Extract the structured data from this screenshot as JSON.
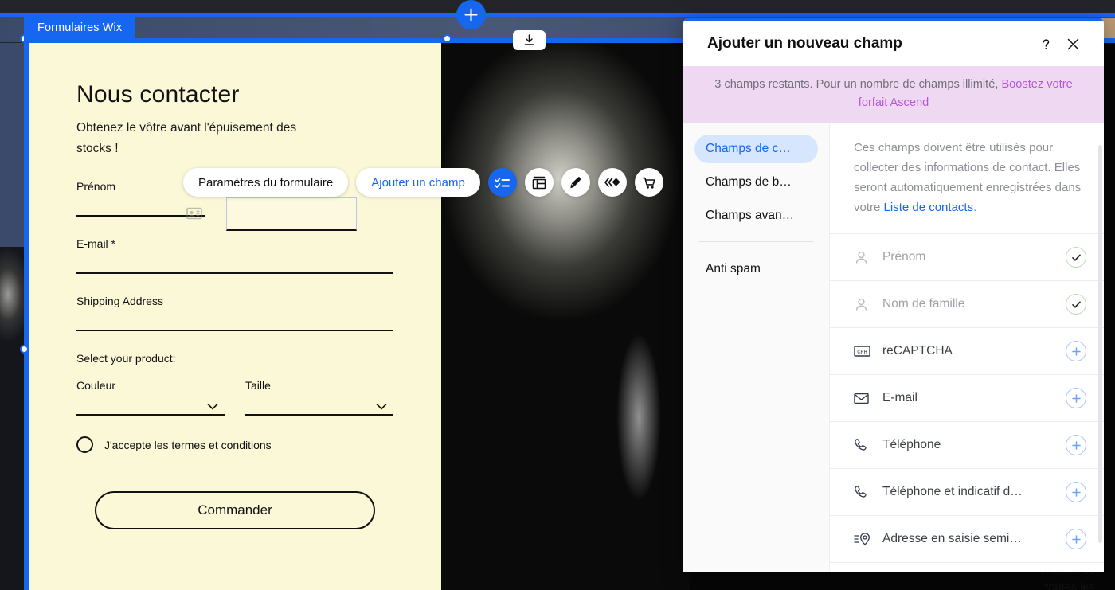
{
  "editor": {
    "site_tab_label": "Formulaires Wix",
    "add_section_icon": "plus-icon",
    "download_icon": "download-icon",
    "accent_blue": "#1666f0",
    "form_bg": "#fbf8d8"
  },
  "toolbar": {
    "settings_label": "Paramètres du formulaire",
    "add_field_label": "Ajouter un champ",
    "icons": [
      {
        "name": "form-fields-icon",
        "glyph": "checklist",
        "active": true
      },
      {
        "name": "layout-icon",
        "glyph": "layout",
        "active": false
      },
      {
        "name": "design-pen-icon",
        "glyph": "pen",
        "active": false
      },
      {
        "name": "animation-icon",
        "glyph": "chevrons",
        "active": false
      },
      {
        "name": "store-icon",
        "glyph": "cart",
        "active": false
      }
    ]
  },
  "form": {
    "title": "Nous contacter",
    "subtitle": "Obtenez le vôtre avant l'épuisement des stocks !",
    "fields": [
      {
        "label": "Prénom"
      },
      {
        "label": "E-mail *"
      },
      {
        "label": "Shipping Address"
      }
    ],
    "select_heading": "Select your product:",
    "selects": [
      {
        "label": "Couleur"
      },
      {
        "label": "Taille"
      }
    ],
    "terms_label": "J'accepte les termes et conditions",
    "submit_label": "Commander"
  },
  "panel": {
    "title": "Ajouter un nouveau champ",
    "help_icon": "question-mark-icon",
    "close_icon": "close-icon",
    "banner": {
      "text": "3 champs restants. Pour un nombre de champs illimité, ",
      "link": "Boostez votre forfait Ascend",
      "bg": "#efd9f2",
      "link_color": "#b857d6"
    },
    "categories": [
      {
        "label": "Champs de c…",
        "selected": true
      },
      {
        "label": "Champs de b…",
        "selected": false
      },
      {
        "label": "Champs avan…",
        "selected": false
      }
    ],
    "categories_extra": [
      {
        "label": "Anti spam",
        "selected": false
      }
    ],
    "description": {
      "part1": "Ces champs doivent être utilisés pour collecter des informations de contact. Elles seront automatiquement enregistrées dans votre ",
      "link": "Liste de contacts",
      "part2": "."
    },
    "fields": [
      {
        "label": "Prénom",
        "icon": "person-icon",
        "state": "added",
        "action": "check-icon"
      },
      {
        "label": "Nom de famille",
        "icon": "person-icon",
        "state": "added",
        "action": "check-icon"
      },
      {
        "label": "reCAPTCHA",
        "icon": "captcha-icon",
        "state": "available",
        "action": "plus-icon"
      },
      {
        "label": "E-mail",
        "icon": "envelope-icon",
        "state": "available",
        "action": "plus-icon"
      },
      {
        "label": "Téléphone",
        "icon": "phone-icon",
        "state": "available",
        "action": "plus-icon"
      },
      {
        "label": "Téléphone et indicatif d…",
        "icon": "phone-icon",
        "state": "available",
        "action": "plus-icon"
      },
      {
        "label": "Adresse en saisie semi…",
        "icon": "address-pin-icon",
        "state": "available",
        "action": "plus-icon"
      }
    ]
  },
  "tooltip": {
    "text": "Afficher sur toutes les"
  }
}
